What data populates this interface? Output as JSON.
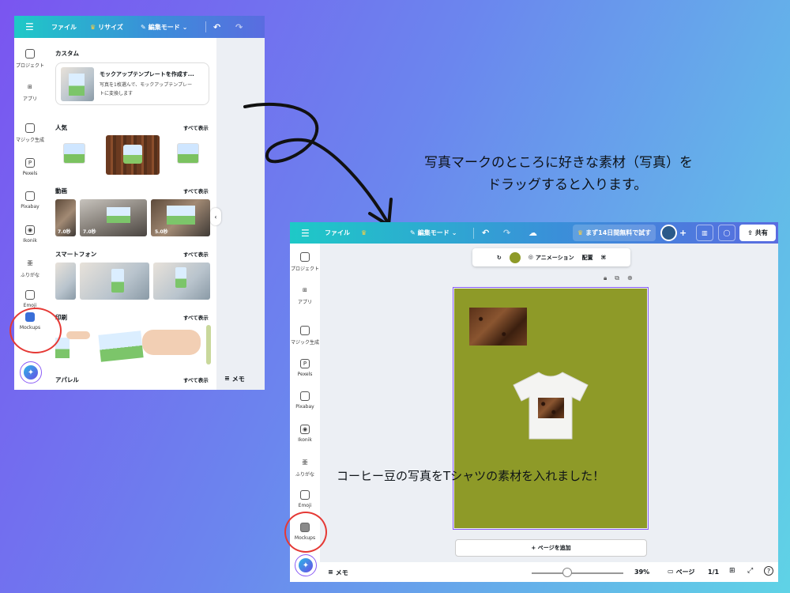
{
  "captions": {
    "instruction_line1": "写真マークのところに好きな素材（写真）を",
    "instruction_line2": "ドラッグすると入ります。",
    "result": "コーヒー豆の写真をTシャツの素材を入れました！"
  },
  "toolbar": {
    "file": "ファイル",
    "resize": "リサイズ",
    "edit_mode": "編集モード",
    "trial": "まず14日間無料で試す",
    "share": "共有"
  },
  "rail": [
    {
      "label": "プロジェクト",
      "icon": "folder-icon"
    },
    {
      "label": "アプリ",
      "icon": "apps-icon"
    },
    {
      "label": "マジック生成",
      "icon": "magic-media-icon"
    },
    {
      "label": "Pexels",
      "icon": "pexels-icon"
    },
    {
      "label": "Pixabay",
      "icon": "pixabay-icon"
    },
    {
      "label": "Ikonik",
      "icon": "ikonik-icon"
    },
    {
      "label": "ふりがな",
      "icon": "furigana-icon"
    },
    {
      "label": "Emoji",
      "icon": "emoji-icon"
    },
    {
      "label": "Mockups",
      "icon": "mockups-icon"
    }
  ],
  "panel": {
    "custom_title": "カスタム",
    "custom_card_title": "モックアップテンプレートを作成す...",
    "custom_card_desc1": "写真を1枚選んで、モックアップテンプレー",
    "custom_card_desc2": "トに変換します",
    "see_all": "すべて表示",
    "sections": [
      "人気",
      "動画",
      "スマートフォン",
      "印刷",
      "アパレル"
    ],
    "durations": [
      "7.0秒",
      "7.0秒",
      "5.0秒"
    ],
    "memo": "メモ"
  },
  "editor": {
    "animation": "アニメーション",
    "position": "配置",
    "add_page": "+ ページを追加",
    "zoom": "39%",
    "pages_label": "ページ",
    "page_count": "1/1",
    "memo": "メモ",
    "fill_color": "#8e9a28",
    "zoom_level": 0.39
  }
}
